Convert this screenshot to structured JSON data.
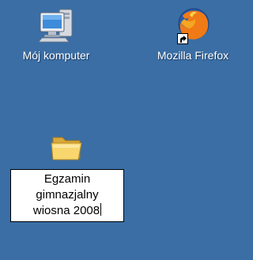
{
  "desktop": {
    "background_color": "#3a6ea5",
    "icons": [
      {
        "id": "my-computer",
        "label": "Mój komputer",
        "icon": "my-computer-icon"
      },
      {
        "id": "firefox",
        "label": "Mozilla Firefox",
        "icon": "firefox-icon",
        "shortcut": true
      },
      {
        "id": "folder",
        "icon": "folder-icon",
        "rename": {
          "lines": [
            "Egzamin",
            "gimnazjalny",
            "wiosna 2008"
          ]
        }
      }
    ]
  }
}
